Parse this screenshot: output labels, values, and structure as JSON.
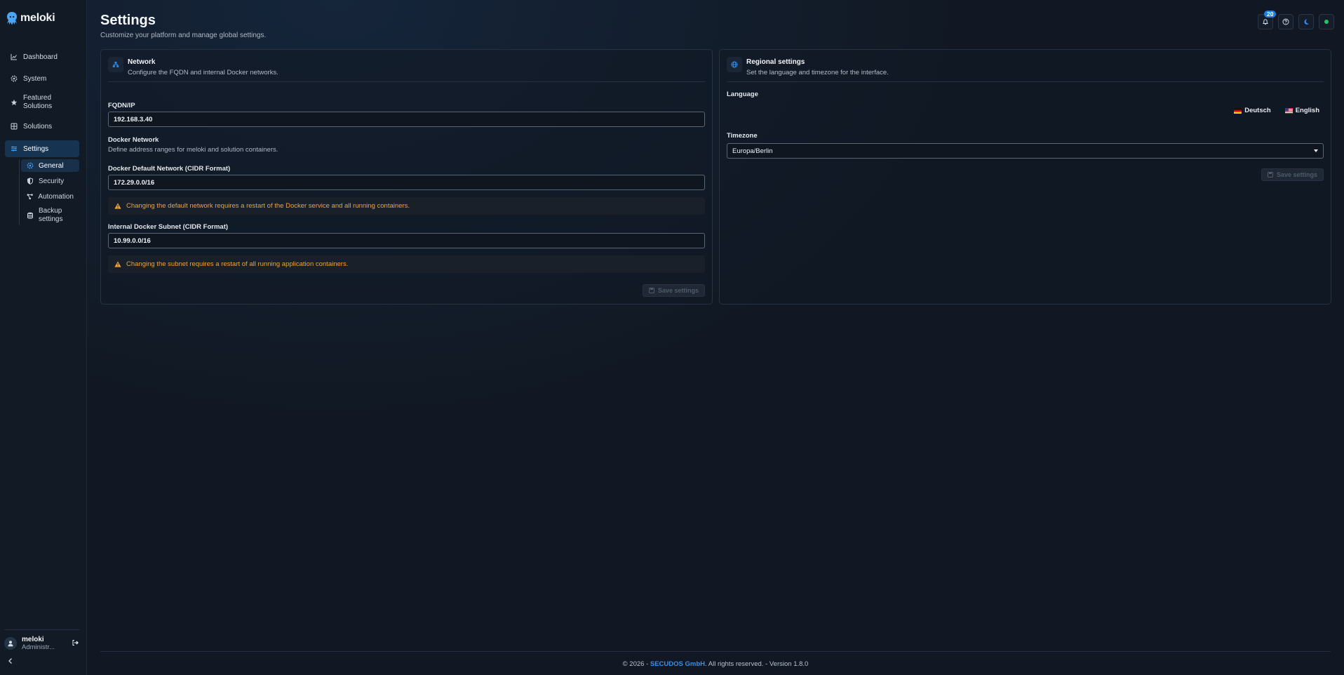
{
  "app": {
    "name": "meloki"
  },
  "sidebar": {
    "items": [
      {
        "label": "Dashboard",
        "icon": "chart-line-icon"
      },
      {
        "label": "System",
        "icon": "gear-icon"
      },
      {
        "label": "Featured Solutions",
        "icon": "star-icon"
      },
      {
        "label": "Solutions",
        "icon": "grid-icon"
      },
      {
        "label": "Settings",
        "icon": "sliders-icon",
        "active": true
      }
    ],
    "sub_items": [
      {
        "label": "General",
        "icon": "gear-icon",
        "active": true
      },
      {
        "label": "Security",
        "icon": "shield-icon"
      },
      {
        "label": "Automation",
        "icon": "nodes-icon"
      },
      {
        "label": "Backup settings",
        "icon": "database-icon"
      }
    ],
    "user": {
      "name": "meloki",
      "role": "Administr..."
    }
  },
  "header": {
    "title": "Settings",
    "subtitle": "Customize your platform and manage global settings.",
    "notification_count": "20"
  },
  "network": {
    "title": "Network",
    "description": "Configure the FQDN and internal Docker networks.",
    "fqdn_label": "FQDN/IP",
    "fqdn_value": "192.168.3.40",
    "docker_title": "Docker Network",
    "docker_desc": "Define address ranges for meloki and solution containers.",
    "default_label": "Docker Default Network (CIDR Format)",
    "default_value": "172.29.0.0/16",
    "default_warning": "Changing the default network requires a restart of the Docker service and all running containers.",
    "subnet_label": "Internal Docker Subnet (CIDR Format)",
    "subnet_value": "10.99.0.0/16",
    "subnet_warning": "Changing the subnet requires a restart of all running application containers.",
    "save_label": "Save settings"
  },
  "regional": {
    "title": "Regional settings",
    "description": "Set the language and timezone for the interface.",
    "language_label": "Language",
    "languages": [
      "Deutsch",
      "English"
    ],
    "timezone_label": "Timezone",
    "timezone_value": "Europa/Berlin",
    "save_label": "Save settings"
  },
  "footer": {
    "prefix": "© 2026 - ",
    "company": "SECUDOS GmbH",
    "suffix": ". All rights reserved. - Version 1.8.0"
  },
  "colors": {
    "accent": "#1e7fe0",
    "warning": "#f0a23a",
    "status_online": "#22c55e"
  }
}
